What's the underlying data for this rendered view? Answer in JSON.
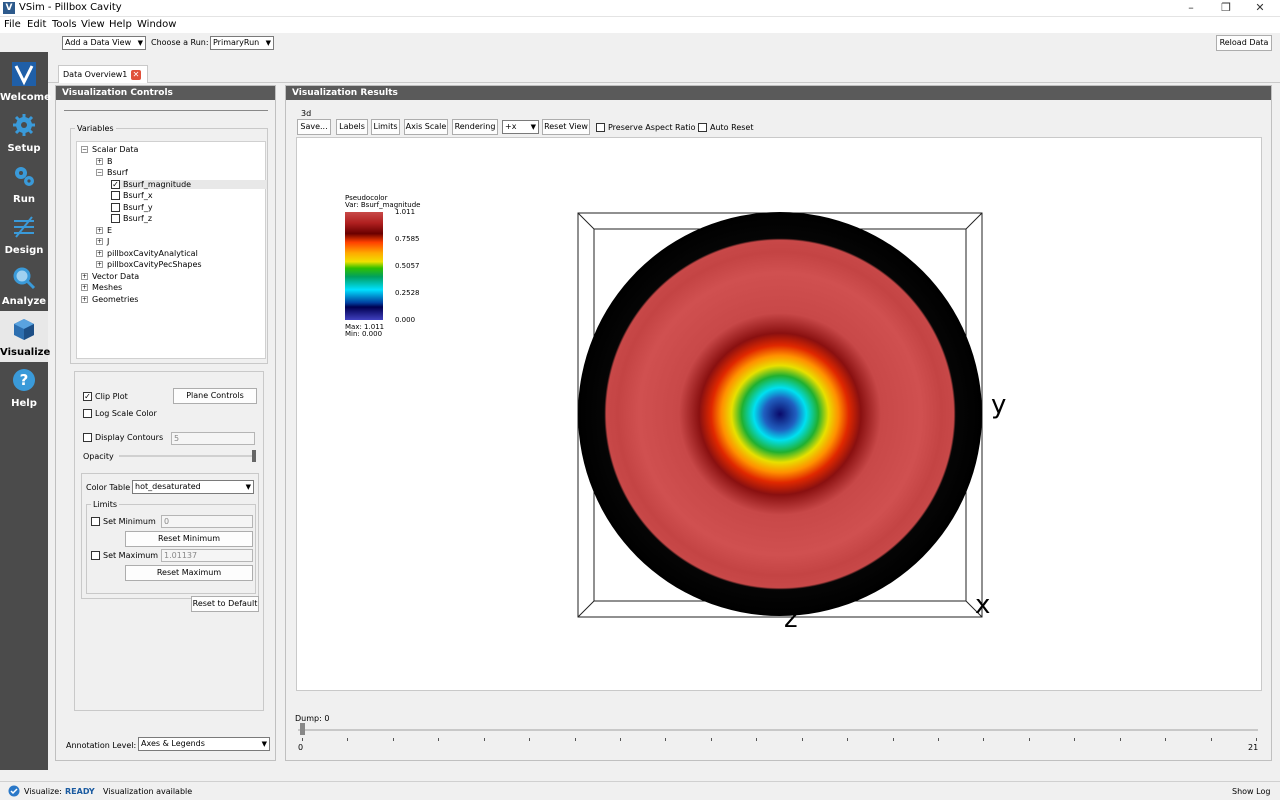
{
  "window": {
    "title": "VSim - Pillbox Cavity",
    "app_icon_letter": "V"
  },
  "menu": [
    "File",
    "Edit",
    "Tools",
    "View",
    "Help",
    "Window"
  ],
  "nav": [
    {
      "label": "Welcome",
      "icon": "vsim-logo-icon"
    },
    {
      "label": "Setup",
      "icon": "gear-icon"
    },
    {
      "label": "Run",
      "icon": "gears-icon"
    },
    {
      "label": "Design",
      "icon": "design-icon"
    },
    {
      "label": "Analyze",
      "icon": "magnifier-icon"
    },
    {
      "label": "Visualize",
      "icon": "cube-icon"
    },
    {
      "label": "Help",
      "icon": "help-icon"
    }
  ],
  "toolbar": {
    "data_view": "Add a Data View",
    "choose_run_label": "Choose a Run:",
    "run": "PrimaryRun",
    "reload": "Reload Data"
  },
  "tab": {
    "label": "Data Overview1"
  },
  "controls": {
    "header": "Visualization Controls",
    "variables_label": "Variables",
    "tree": [
      {
        "label": "Scalar Data",
        "level": 0,
        "type": "minus"
      },
      {
        "label": "B",
        "level": 1,
        "type": "plus"
      },
      {
        "label": "Bsurf",
        "level": 1,
        "type": "minus"
      },
      {
        "label": "Bsurf_magnitude",
        "level": 2,
        "type": "checked"
      },
      {
        "label": "Bsurf_x",
        "level": 2,
        "type": "check"
      },
      {
        "label": "Bsurf_y",
        "level": 2,
        "type": "check"
      },
      {
        "label": "Bsurf_z",
        "level": 2,
        "type": "check"
      },
      {
        "label": "E",
        "level": 1,
        "type": "plus"
      },
      {
        "label": "J",
        "level": 1,
        "type": "plus"
      },
      {
        "label": "pillboxCavityAnalytical",
        "level": 1,
        "type": "plus"
      },
      {
        "label": "pillboxCavityPecShapes",
        "level": 1,
        "type": "plus"
      },
      {
        "label": "Vector Data",
        "level": 0,
        "type": "plus"
      },
      {
        "label": "Meshes",
        "level": 0,
        "type": "plus"
      },
      {
        "label": "Geometries",
        "level": 0,
        "type": "plus"
      }
    ],
    "clip_plot": "Clip Plot",
    "plane_controls": "Plane Controls",
    "log_scale": "Log Scale Color",
    "display_contours": "Display Contours",
    "contours_value": "5",
    "opacity": "Opacity",
    "color_table_label": "Color Table",
    "color_table": "hot_desaturated",
    "limits_label": "Limits",
    "set_minimum": "Set Minimum",
    "min_value": "0",
    "reset_minimum": "Reset Minimum",
    "set_maximum": "Set Maximum",
    "max_value": "1.01137",
    "reset_maximum": "Reset Maximum",
    "reset_default": "Reset to Default",
    "annotation_label": "Annotation Level:",
    "annotation_value": "Axes & Legends"
  },
  "results": {
    "header": "Visualization Results",
    "group_label": "3d",
    "buttons": [
      "Save...",
      "Labels",
      "Limits",
      "Axis Scale",
      "Rendering"
    ],
    "view_axis": "+x",
    "reset_view": "Reset View",
    "preserve_aspect": "Preserve Aspect Ratio",
    "auto_reset": "Auto Reset",
    "legend": {
      "title": "Pseudocolor",
      "var": "Var: Bsurf_magnitude",
      "ticks": [
        "1.011",
        "0.7585",
        "0.5057",
        "0.2528",
        "0.000"
      ],
      "max": "Max:  1.011",
      "min": "Min:  0.000"
    },
    "axis_y": "y",
    "axis_z": "z",
    "axis_x": "x",
    "dump_label": "Dump: 0",
    "slider_min": "0",
    "slider_max": "21"
  },
  "status": {
    "label": "Visualize:",
    "state": "READY",
    "message": "Visualization available",
    "show_log": "Show Log"
  }
}
